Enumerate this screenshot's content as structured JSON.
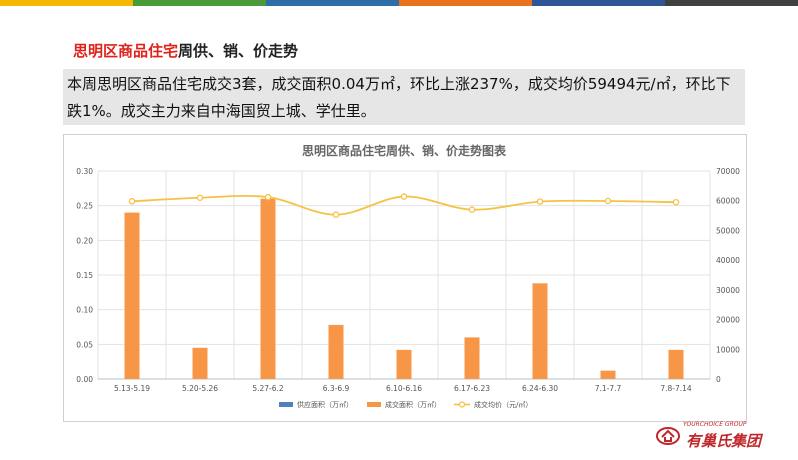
{
  "header": {
    "title_red": "思明区商品住宅",
    "title_rest": "周供、销、价走势"
  },
  "summary": {
    "text": "本周思明区商品住宅成交3套，成交面积0.04万㎡，环比上涨237%，成交均价59494元/㎡，环比下跌1%。成交主力来自中海国贸上城、学仕里。"
  },
  "colors": {
    "topbar": [
      "#f5b800",
      "#4b9a3a",
      "#2e6ea6",
      "#e8731c",
      "#2f5597",
      "#404040"
    ],
    "supply": "#4f81bd",
    "area": "#f79646",
    "price": "#f5c242",
    "title_red": "#e0221c",
    "logo": "#c0282b"
  },
  "logo": {
    "small_text": "YOURCHOICE GROUP",
    "name": "有巢氏集团"
  },
  "chart_data": {
    "type": "bar",
    "title": "思明区商品住宅周供、销、价走势图表",
    "categories": [
      "5.13-5.19",
      "5.20-5.26",
      "5.27-6.2",
      "6.3-6.9",
      "6.10-6.16",
      "6.17-6.23",
      "6.24-6.30",
      "7.1-7.7",
      "7.8-7.14"
    ],
    "series": [
      {
        "name": "供应面积（万㎡）",
        "type": "bar",
        "axis": "left",
        "values": [
          0,
          0,
          0,
          0,
          0,
          0,
          0,
          0,
          0
        ]
      },
      {
        "name": "成交面积（万㎡）",
        "type": "bar",
        "axis": "left",
        "values": [
          0.24,
          0.045,
          0.26,
          0.078,
          0.042,
          0.06,
          0.138,
          0.012,
          0.042
        ]
      },
      {
        "name": "成交均价（元/㎡）",
        "type": "line",
        "axis": "right",
        "values": [
          59800,
          61000,
          61200,
          55300,
          61400,
          57000,
          59700,
          59900,
          59494
        ]
      }
    ],
    "y_left": {
      "min": 0,
      "max": 0.3,
      "ticks": [
        "0.00",
        "0.05",
        "0.10",
        "0.15",
        "0.20",
        "0.25",
        "0.30"
      ]
    },
    "y_right": {
      "min": 0,
      "max": 70000,
      "ticks": [
        "0",
        "10000",
        "20000",
        "30000",
        "40000",
        "50000",
        "60000",
        "70000"
      ]
    },
    "grid": true,
    "legend_position": "bottom"
  }
}
